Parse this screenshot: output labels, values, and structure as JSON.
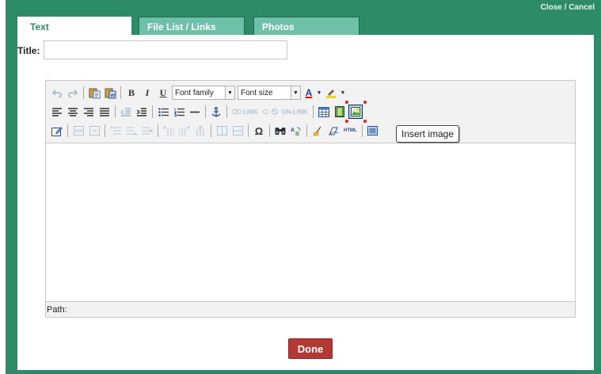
{
  "header": {
    "close_label": "Close / Cancel"
  },
  "tabs": [
    {
      "label": "Text",
      "active": true
    },
    {
      "label": "File List / Links",
      "active": false
    },
    {
      "label": "Photos",
      "active": false
    }
  ],
  "form": {
    "title_label": "Title:",
    "title_value": ""
  },
  "toolbar": {
    "font_family": "Font family",
    "font_size": "Font size",
    "link_label": "LINK",
    "unlink_label": "UN-LINK",
    "html_label": "HTML",
    "omega_label": "Ω",
    "bold_label": "B",
    "italic_label": "I",
    "underline_label": "U",
    "color_label": "A",
    "insert_image_tooltip": "Insert image"
  },
  "editor": {
    "path_label": "Path:"
  },
  "footer": {
    "done_label": "Done"
  },
  "colors": {
    "frame_green": "#2e8b68",
    "tab_inactive": "#6fc0a8",
    "done_red": "#b23a35"
  }
}
